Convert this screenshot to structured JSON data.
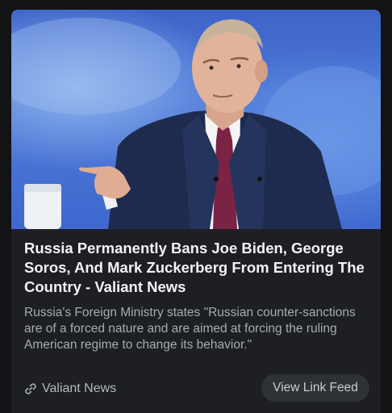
{
  "post": {
    "image_alt": "Vladimir Putin in a navy suit and maroon tie pointing with his right hand, blue backdrop",
    "title": "Russia Permanently Bans Joe Biden, George Soros, And Mark Zuckerberg From Entering The Country - Valiant News",
    "description": "Russia's Foreign Ministry states \"Russian counter-sanctions are of a forced nature and are aimed at forcing the ruling American regime to change its behavior.\"",
    "source_name": "Valiant News",
    "source_icon": "link-icon",
    "feed_button_label": "View Link Feed"
  },
  "colors": {
    "page_bg": "#121315",
    "card_bg": "#1d1f23",
    "title_text": "#f2f3f5",
    "body_text": "#a7abb3",
    "button_bg": "#2e3136"
  }
}
